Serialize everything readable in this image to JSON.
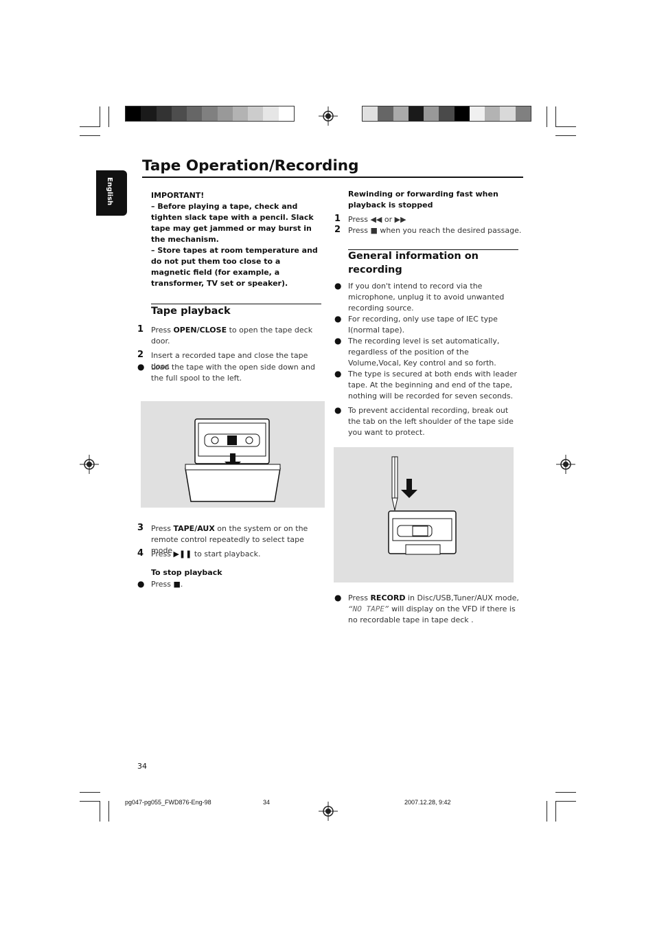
{
  "header": {
    "title": "Tape Operation/Recording",
    "language_tab": "English"
  },
  "swatches": {
    "left": [
      "#000000",
      "#1a1a1a",
      "#333333",
      "#4d4d4d",
      "#666666",
      "#808080",
      "#999999",
      "#b3b3b3",
      "#cccccc",
      "#e6e6e6",
      "#ffffff"
    ],
    "right": [
      "#e0e0e0",
      "#666666",
      "#aaaaaa",
      "#1a1a1a",
      "#999999",
      "#4a4a4a",
      "#000000",
      "#f0f0f0",
      "#b3b3b3",
      "#d9d9d9",
      "#808080"
    ]
  },
  "important": {
    "title": "IMPORTANT!",
    "items": [
      "–   Before playing a tape, check and tighten slack tape with a pencil. Slack tape may get jammed or may burst in the mechanism.",
      "–   Store tapes at room temperature and do not put them too close to a magnetic field (for example, a transformer, TV set or speaker)."
    ]
  },
  "playback": {
    "heading": "Tape playback",
    "s1_num": "1",
    "s1_pre": "Press ",
    "s1_bold": "OPEN/CLOSE",
    "s1_post": " to open the tape deck door.",
    "s2_num": "2",
    "s2": "Insert a recorded tape and close the tape door.",
    "b1": "Load the tape with the open side down and the full spool to the left.",
    "s3_num": "3",
    "s3_pre": "Press ",
    "s3_bold": "TAPE/AUX",
    "s3_post": " on the system or on the remote control repeatedly to select tape mode",
    "s4_num": "4",
    "s4_pre": "Press ",
    "s4_sym": "▶❚❚",
    "s4_post": " to start playback.",
    "stop_heading": "To stop playback",
    "stop_pre": "Press ",
    "stop_sym": "■",
    "stop_post": "."
  },
  "rewind": {
    "heading": "Rewinding or forwarding fast when playback is stopped",
    "s1_num": "1",
    "s1": "Press ◀◀ or ▶▶",
    "s2_num": "2",
    "s2": "Press ■ when you reach the desired passage."
  },
  "recording": {
    "heading": "General information on recording",
    "bullets": [
      "If you don't intend to record via the microphone, unplug it to avoid unwanted recording source.",
      "For recording, only use tape of IEC type I(normal tape).",
      "The recording level is set automatically, regardless of the position of the Volume,Vocal,  Key control and so forth.",
      "The type is secured at both ends with leader tape. At the beginning and end of the tape, nothing will be recorded for seven seconds.",
      "To prevent accidental recording, break out the tab on the left shoulder of the tape side you want to protect."
    ],
    "record_pre": "Press ",
    "record_bold": "RECORD",
    "record_post": " in Disc/USB,Tuner/AUX mode,",
    "record_display": "“NO  TAPE”",
    "record_rest": "  will display on the VFD if there is no recordable tape in tape deck ."
  },
  "footer": {
    "page_number": "34",
    "file": "pg047-pg055_FWD876-Eng-98",
    "sheet": "34",
    "date": "2007.12.28, 9:42"
  },
  "bullet_symbol": "●"
}
